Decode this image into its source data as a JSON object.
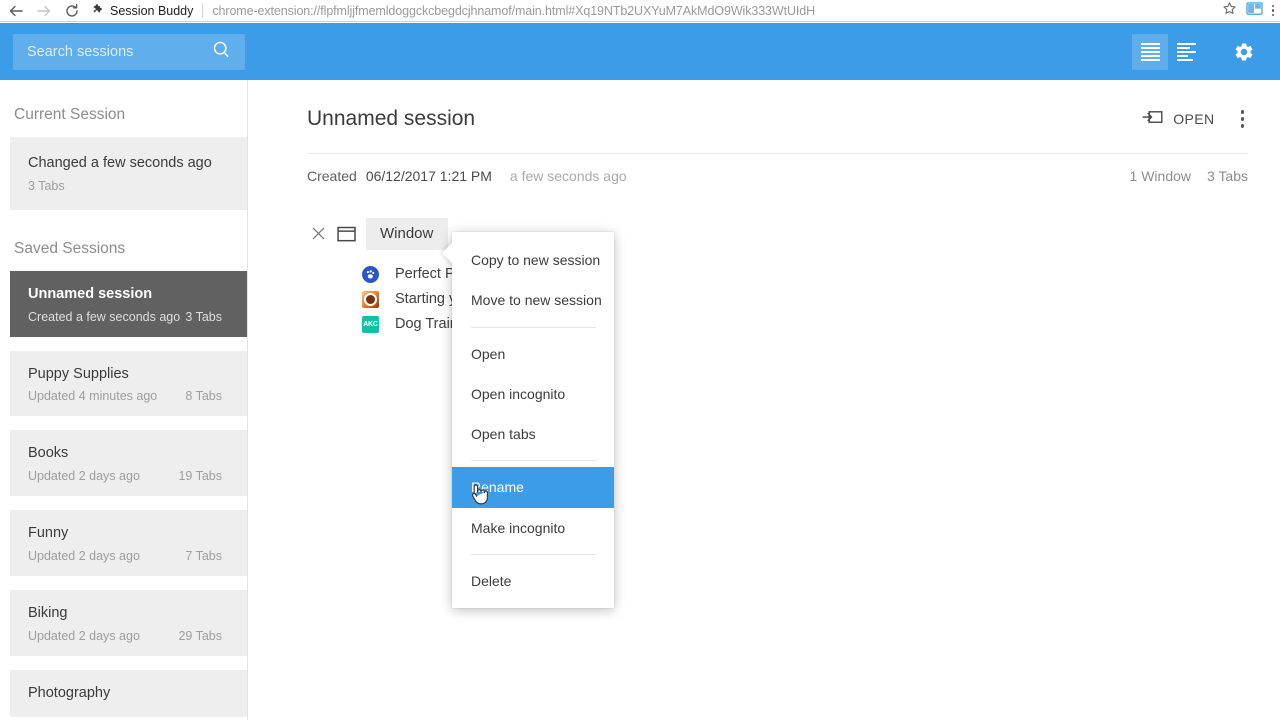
{
  "browser": {
    "back_icon": "back-arrow-icon",
    "forward_icon": "forward-arrow-icon",
    "reload_icon": "reload-icon",
    "extension_title": "Session Buddy",
    "url": "chrome-extension://flpfmljjfmemldoggckcbegdcjhnamof/main.html#Xq19NTb2UXYuM7AkMdO9Wik333WtUIdH",
    "bookmark_icon": "star-icon",
    "extension_icon": "session-buddy-extension-icon",
    "menu_icon": "chrome-menu-icon"
  },
  "header": {
    "search_placeholder": "Search sessions",
    "search_value": "",
    "search_icon": "search-icon",
    "view_list_icon": "list-view-icon",
    "view_compact_icon": "compact-view-icon",
    "settings_icon": "gear-icon",
    "accent_color": "#3d9ce8"
  },
  "sidebar": {
    "current_heading": "Current Session",
    "saved_heading": "Saved Sessions",
    "current_session": {
      "title": "Changed a few seconds ago",
      "tabs": "3 Tabs"
    },
    "saved_sessions": [
      {
        "title": "Unnamed session",
        "updated": "Created a few seconds ago",
        "tabs": "3 Tabs",
        "selected": true
      },
      {
        "title": "Puppy Supplies",
        "updated": "Updated 4 minutes ago",
        "tabs": "8 Tabs",
        "selected": false
      },
      {
        "title": "Books",
        "updated": "Updated 2 days ago",
        "tabs": "19 Tabs",
        "selected": false
      },
      {
        "title": "Funny",
        "updated": "Updated 2 days ago",
        "tabs": "7 Tabs",
        "selected": false
      },
      {
        "title": "Biking",
        "updated": "Updated 2 days ago",
        "tabs": "29 Tabs",
        "selected": false
      },
      {
        "title": "Photography",
        "updated": "",
        "tabs": "",
        "selected": false
      }
    ]
  },
  "main": {
    "session_title": "Unnamed session",
    "open_label": "OPEN",
    "open_icon": "open-window-icon",
    "more_icon": "more-vertical-icon",
    "created_label": "Created",
    "created_date": "06/12/2017 1:21 PM",
    "created_relative": "a few seconds ago",
    "window_count": "1 Window",
    "tab_count": "3 Tabs",
    "window": {
      "close_icon": "close-icon",
      "window_icon": "window-icon",
      "label": "Window",
      "tabs": [
        {
          "favicon": "paw-favicon",
          "title": "Perfect P…to Train a Puppy"
        },
        {
          "favicon": "ring-favicon",
          "title": "Starting y…r's Way"
        },
        {
          "favicon": "akc-favicon",
          "title": "Dog Train…nnel Club"
        }
      ]
    }
  },
  "context_menu": {
    "items": [
      {
        "label": "Copy to new session",
        "highlight": false,
        "separator_after": false
      },
      {
        "label": "Move to new session",
        "highlight": false,
        "separator_after": true
      },
      {
        "label": "Open",
        "highlight": false,
        "separator_after": false
      },
      {
        "label": "Open incognito",
        "highlight": false,
        "separator_after": false
      },
      {
        "label": "Open tabs",
        "highlight": false,
        "separator_after": true
      },
      {
        "label": "Rename",
        "highlight": true,
        "separator_after": false
      },
      {
        "label": "Make incognito",
        "highlight": false,
        "separator_after": true
      },
      {
        "label": "Delete",
        "highlight": false,
        "separator_after": false
      }
    ],
    "highlight_color": "#3d9ce8"
  }
}
